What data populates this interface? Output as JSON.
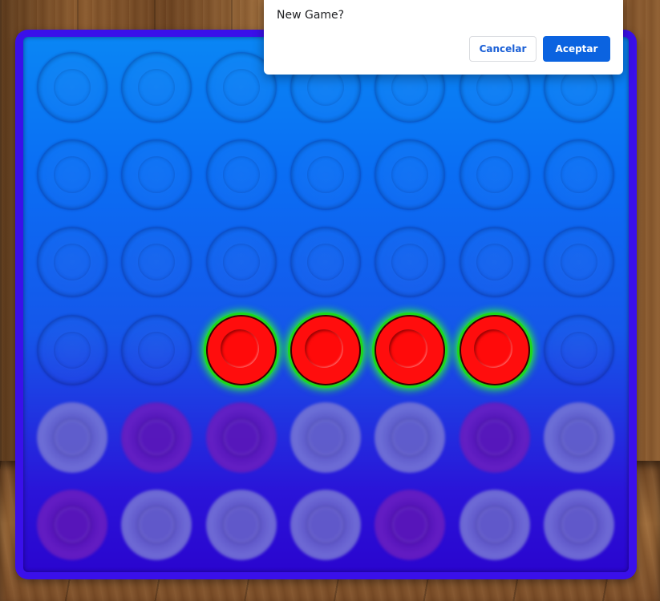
{
  "dialog": {
    "message": "New Game?",
    "cancel_label": "Cancelar",
    "ok_label": "Aceptar"
  },
  "board": {
    "columns": 7,
    "rows": 6,
    "grid": [
      [
        "empty",
        "empty",
        "empty",
        "empty",
        "empty",
        "empty",
        "empty"
      ],
      [
        "empty",
        "empty",
        "empty",
        "empty",
        "empty",
        "empty",
        "empty"
      ],
      [
        "empty",
        "empty",
        "empty",
        "empty",
        "empty",
        "empty",
        "empty"
      ],
      [
        "empty",
        "empty",
        "red-win",
        "red-win",
        "red-win",
        "red-win",
        "empty"
      ],
      [
        "gray",
        "purple",
        "purple",
        "gray",
        "gray",
        "purple",
        "gray"
      ],
      [
        "purple",
        "gray",
        "gray",
        "gray",
        "purple",
        "gray",
        "gray"
      ]
    ]
  },
  "colors": {
    "board_frame": "#3a10ea",
    "winning_disc": "#ff0d0d",
    "winning_glow": "#2aff2a",
    "primary_button": "#0b63e0"
  }
}
